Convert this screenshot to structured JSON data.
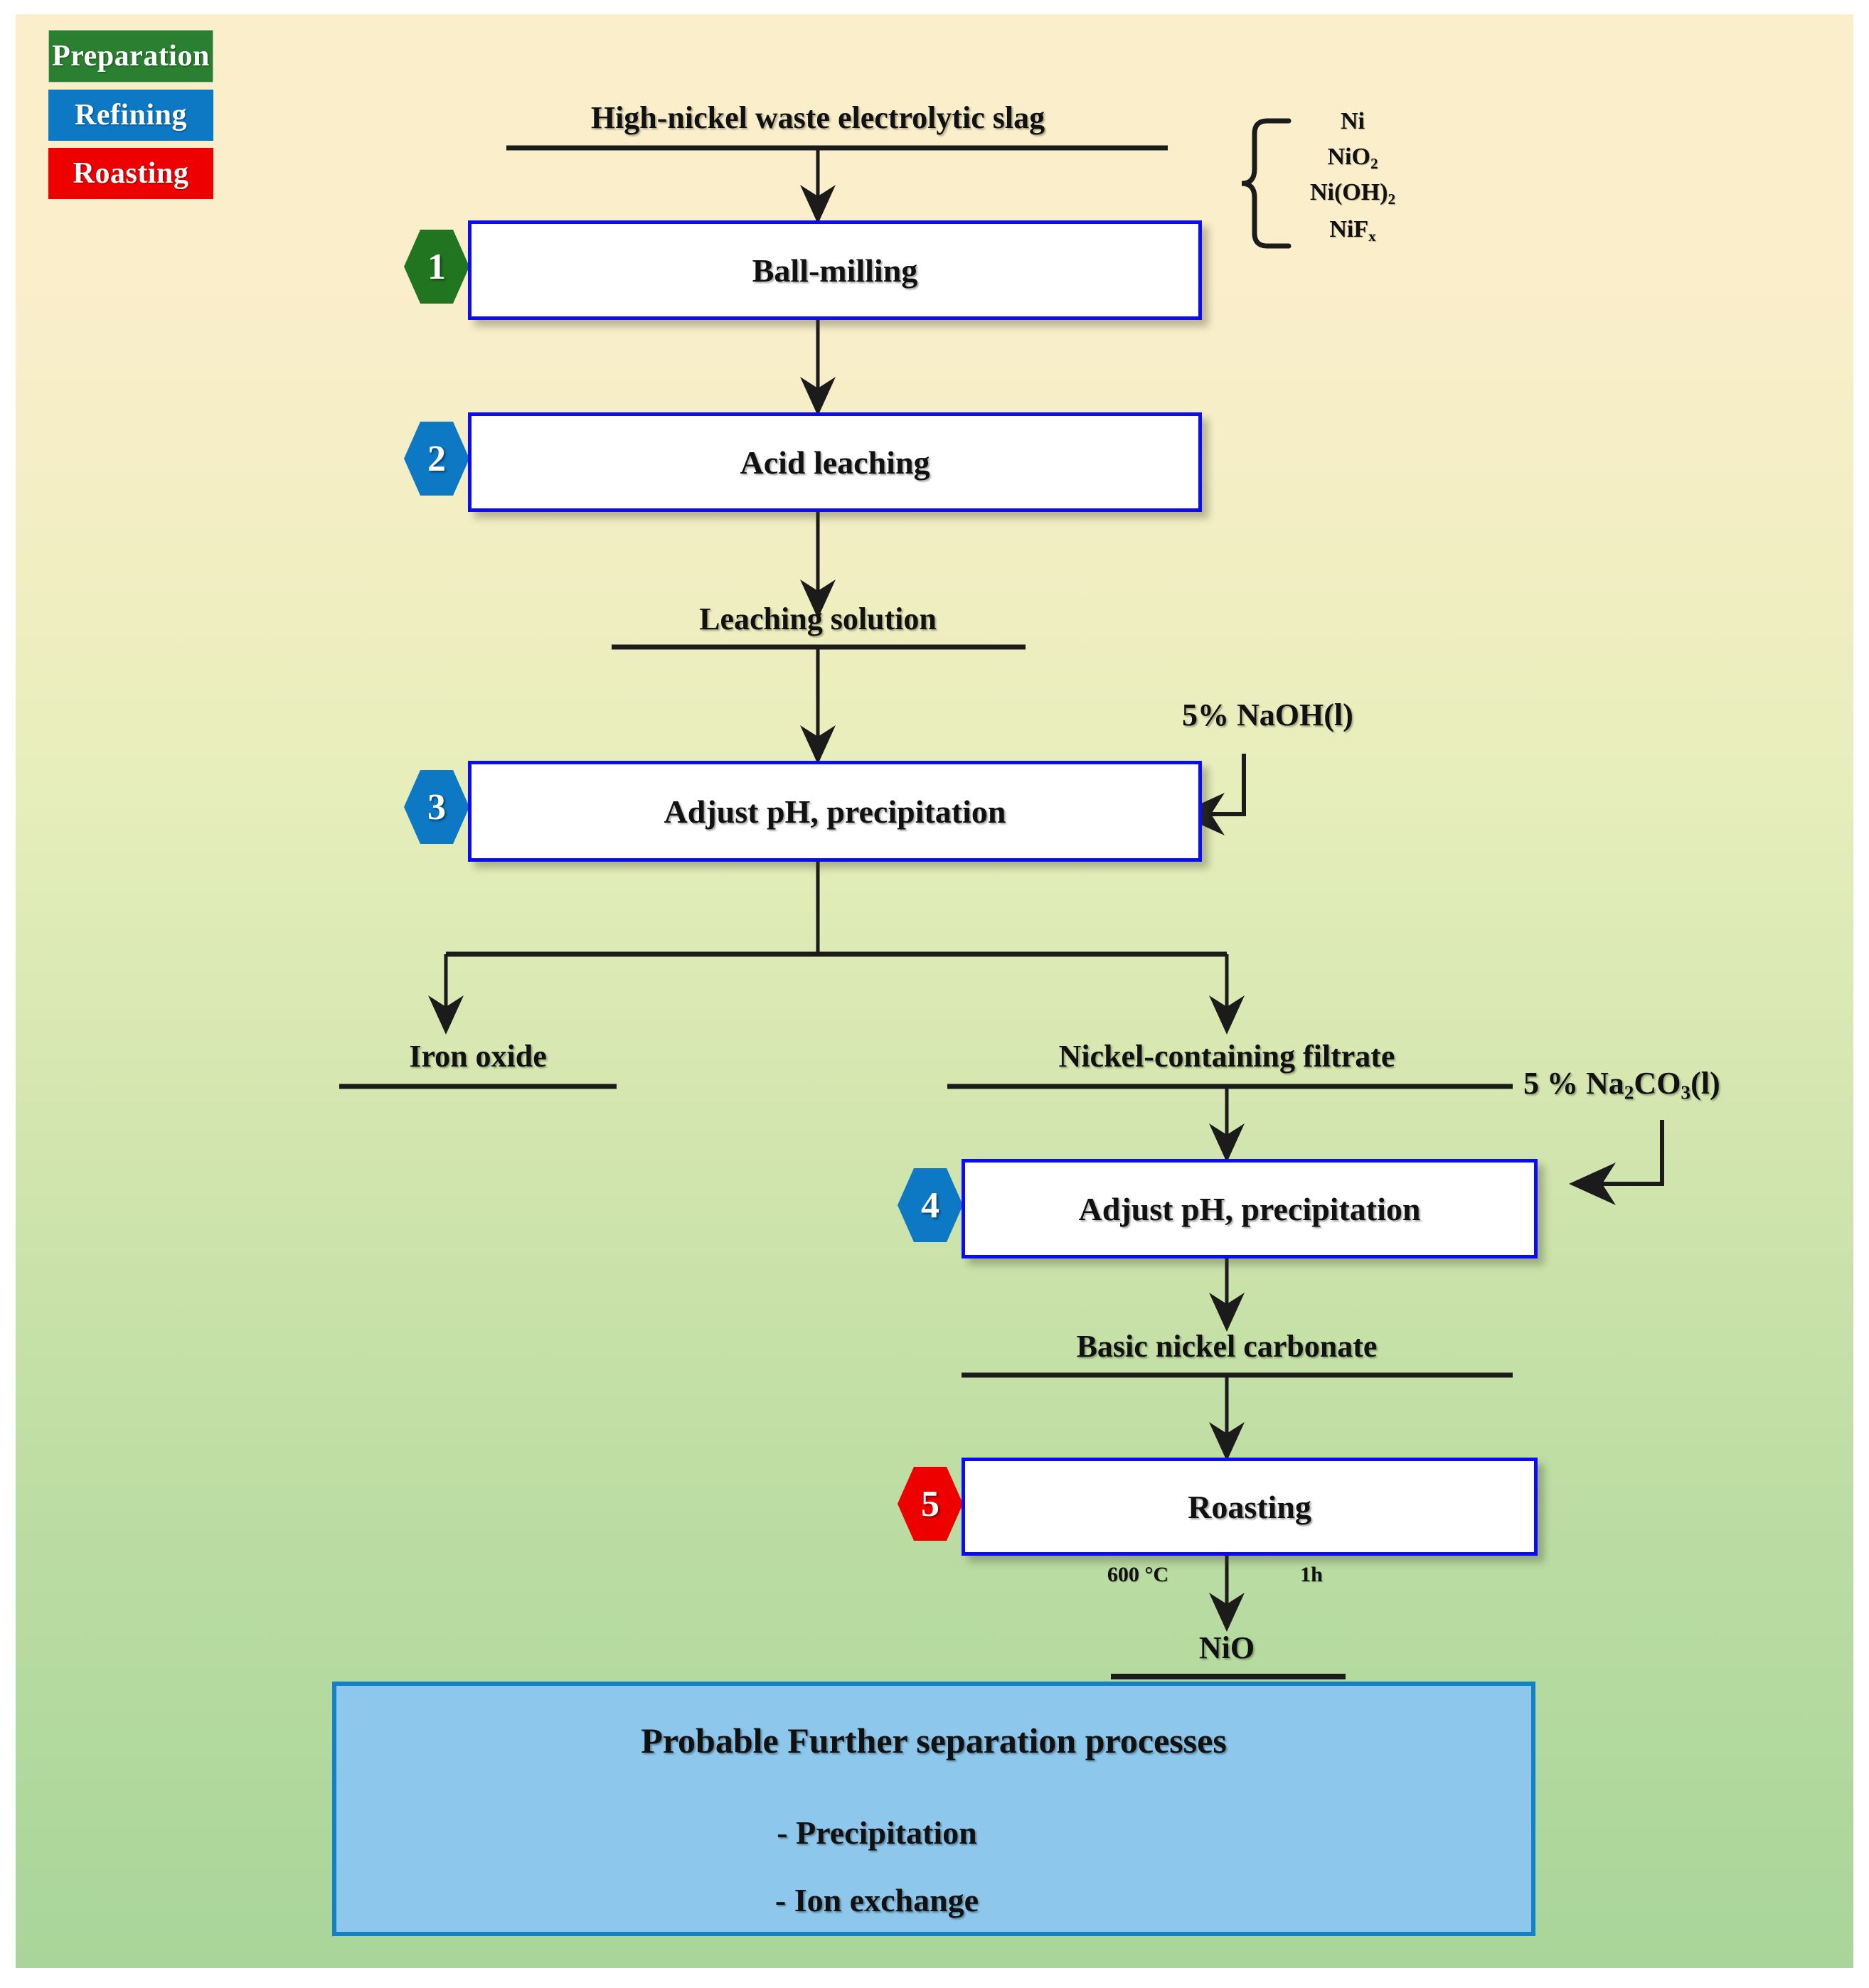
{
  "legend": {
    "items": [
      {
        "label": "Preparation",
        "color": "#2a8030"
      },
      {
        "label": "Refining",
        "color": "#0d79c4"
      },
      {
        "label": "Roasting",
        "color": "#ee0000"
      }
    ]
  },
  "flow": {
    "input_label": "High-nickel waste electrolytic slag",
    "feedstock": [
      "Ni",
      "NiO2",
      "Ni(OH)2",
      "NiFx"
    ],
    "steps": [
      {
        "num": "1",
        "label": "Ball-milling",
        "badge_color": "#217521"
      },
      {
        "num": "2",
        "label": "Acid leaching",
        "badge_color": "#0d79c4"
      },
      {
        "num": "3",
        "label": "Adjust pH, precipitation",
        "badge_color": "#0d79c4"
      },
      {
        "num": "4",
        "label": "Adjust pH, precipitation",
        "badge_color": "#0d79c4"
      },
      {
        "num": "5",
        "label": "Roasting",
        "badge_color": "#ee0000"
      }
    ],
    "intermediates": {
      "leaching_solution": "Leaching solution",
      "iron_oxide": "Iron oxide",
      "nickel_filtrate": "Nickel-containing filtrate",
      "basic_nickel_carbonate": "Basic nickel carbonate",
      "product": "NiO"
    },
    "reagents": {
      "naoh": "5% NaOH(l)",
      "na2co3": "5 % Na2CO3(l)"
    },
    "roast_conditions": {
      "temperature": "600 °C",
      "time": "1h"
    }
  },
  "panel": {
    "title": "Probable Further separation processes",
    "items": [
      "- Precipitation",
      "- Ion exchange"
    ],
    "fill": "#8ec7ec",
    "border": "#1182c8"
  }
}
